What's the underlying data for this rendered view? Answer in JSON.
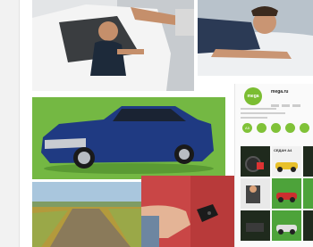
{
  "profile": {
    "avatar_text": "mega",
    "name": "mega.ru"
  },
  "highlights": [
    "A5",
    "",
    "",
    "",
    ""
  ],
  "posts": [
    "СЕДАН A4",
    "",
    "",
    "",
    "",
    "",
    ""
  ],
  "colors": {
    "accent_green": "#74b843",
    "car_blue": "#1f3a82",
    "key_red": "#c94646"
  }
}
